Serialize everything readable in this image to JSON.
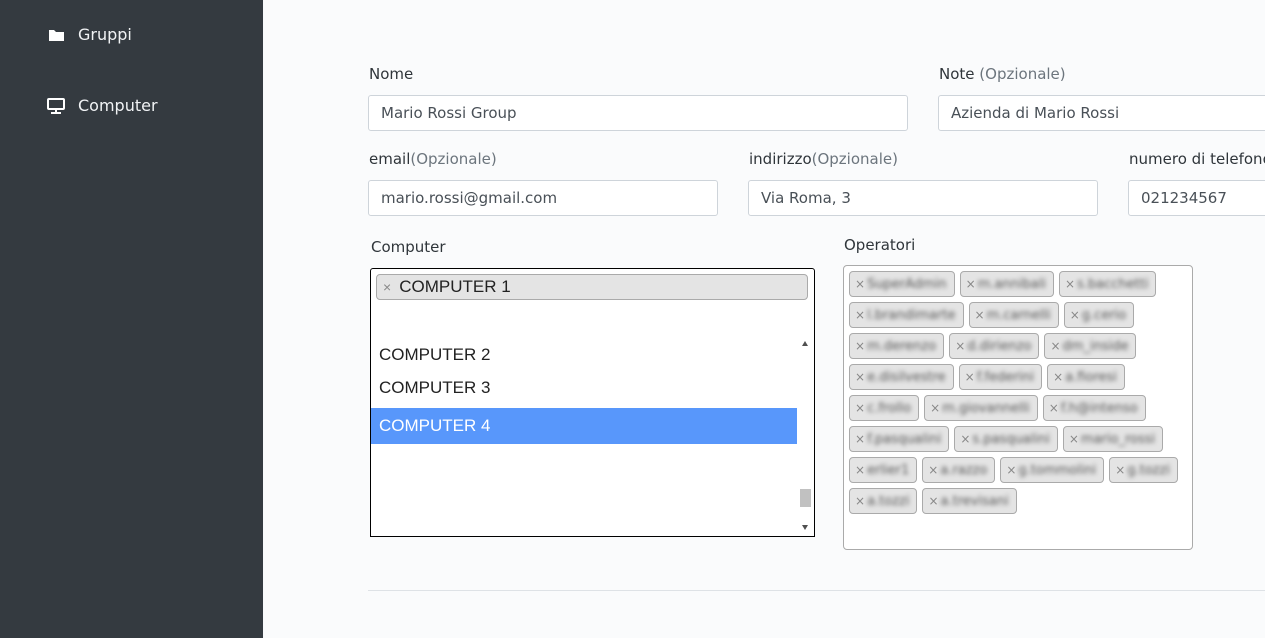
{
  "sidebar": {
    "items": [
      {
        "label": "Gruppi",
        "icon": "folder-icon"
      },
      {
        "label": "Computer",
        "icon": "monitor-icon"
      }
    ]
  },
  "form": {
    "nome": {
      "label": "Nome",
      "value": "Mario Rossi Group"
    },
    "note": {
      "label": "Note",
      "optional": "(Opzionale)",
      "value": "Azienda di Mario Rossi"
    },
    "email": {
      "label": "email",
      "optional": "(Opzionale)",
      "value": "mario.rossi@gmail.com"
    },
    "indirizzo": {
      "label": "indirizzo",
      "optional": "(Opzionale)",
      "value": "Via Roma, 3"
    },
    "telefono": {
      "label": "numero di telefono",
      "value": "021234567"
    },
    "computer": {
      "label": "Computer",
      "selected": [
        {
          "remove": "×",
          "label": "COMPUTER 1"
        }
      ],
      "options": [
        "COMPUTER 2",
        "COMPUTER 3",
        "COMPUTER 4"
      ],
      "highlighted": "COMPUTER 4"
    },
    "operatori": {
      "label": "Operatori",
      "chips": [
        "SuperAdmin",
        "m.annibali",
        "s.bacchetti",
        "l.brandimarte",
        "m.carnelli",
        "g.cerio",
        "m.derenzo",
        "d.dirienzo",
        "dm_inside",
        "e.disilvestre",
        "f.federini",
        "a.fioresi",
        "c.frollo",
        "m.giovannelli",
        "f.h@intenso",
        "f.pasqualini",
        "s.pasqualini",
        "mario_rossi",
        "erlier1",
        "a.razzo",
        "g.tommolini",
        "g.tozzi",
        "a.tozzi",
        "a.trevisani"
      ]
    }
  }
}
